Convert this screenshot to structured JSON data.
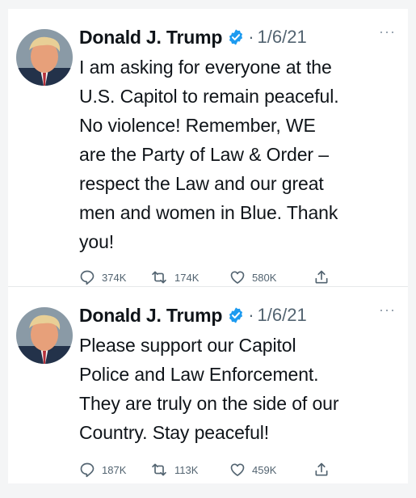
{
  "tweets": [
    {
      "author": "Donald J. Trump",
      "separator": "·",
      "date": "1/6/21",
      "more": "···",
      "text": "I am asking for everyone at the\nU.S. Capitol to remain peaceful.\nNo violence! Remember, WE\nare the Party of Law & Order –\nrespect the Law and our great\nmen and women in Blue. Thank\nyou!",
      "replies": "374K",
      "retweets": "174K",
      "likes": "580K"
    },
    {
      "author": "Donald J. Trump",
      "separator": "·",
      "date": "1/6/21",
      "more": "···",
      "text": "Please support our Capitol\nPolice and Law Enforcement.\nThey are truly on the side of our\nCountry. Stay peaceful!",
      "replies": "187K",
      "retweets": "113K",
      "likes": "459K"
    }
  ],
  "icons": {
    "verified": "verified-badge-icon",
    "reply": "reply-icon",
    "retweet": "retweet-icon",
    "like": "heart-icon",
    "share": "share-icon"
  },
  "colors": {
    "verified": "#1d9bf0",
    "muted": "#536471",
    "text": "#0f1419"
  }
}
